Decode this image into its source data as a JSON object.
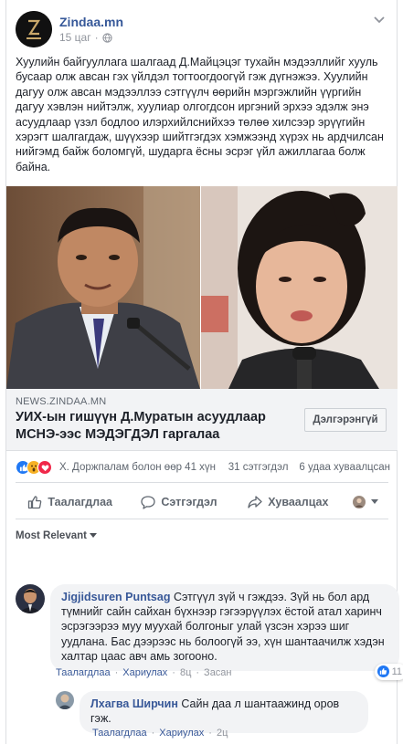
{
  "post": {
    "page_name": "Zindaa.mn",
    "time": "15 цаг",
    "dot": "·",
    "text": "Хуулийн байгууллага шалгаад Д.Майцэцэг тухайн мэдээллийг хууль бусаар олж авсан гэх үйлдэл тогтоогдоогүй гэж дүгнэжээ. Хуулийн дагуу олж авсан мэдээллээ сэтгүүлч өөрийн мэргэжлийн үүргийн дагуу хэвлэн нийтэлж, хуулиар олгогдсон иргэний эрхээ эдэлж энэ асуудлаар үзэл бодлоо илэрхийлснийхээ төлөө хилсээр эрүүгийн хэрэгт шалгагдаж, шүүхээр шийтгэгдэх хэмжээнд хүрэх нь ардчилсан нийгэмд байж боломгүй, шударга ёсны эсрэг үйл ажиллагаа болж байна."
  },
  "link": {
    "domain": "NEWS.ZINDAA.MN",
    "title": "УИХ-ын гишүүн Д.Муратын асуудлаар МСНЭ-ээс МЭДЭГДЭЛ гаргалаа",
    "more_button": "Дэлгэрэнгүй"
  },
  "stats": {
    "reactions_text": "Х. Доржпалам болон өөр 41 хүн",
    "comments": "31 сэтгэгдэл",
    "shares": "6 удаа хуваалцсан"
  },
  "actions": {
    "like": "Таалагдлаа",
    "comment": "Сэтгэгдэл",
    "share": "Хуваалцах"
  },
  "filter": {
    "label": "Most Relevant"
  },
  "comments": [
    {
      "author": "Jigjidsuren Puntsag",
      "text": "Сэтгүүл зүй ч гэждээ. Зүй нь бол ард түмнийг сайн сайхан бүхнээр гэгээрүүлэх ёстой атал харинч эсрэгээрээ муу муухай болгоныг улай үзсэн хэрээ шиг уудлана. Бас дээрээс нь болоогүй ээ, хүн шантаачилж хэдэн халтар цаас авч амь зогооно.",
      "like_label": "Таалагдлаа",
      "reply_label": "Хариулах",
      "time": "8ц",
      "edited": "Засан",
      "likes": "11"
    },
    {
      "author": "Лхагва Ширчин",
      "text": "Сайн даа л шантаажинд оров гэж.",
      "like_label": "Таалагдлаа",
      "reply_label": "Хариулах",
      "time": "2ц"
    }
  ],
  "colors": {
    "link_blue": "#385898",
    "meta_gray": "#90949c",
    "bubble_bg": "#f2f3f5",
    "like_blue": "#2078f4",
    "love_red": "#f0284a",
    "wow_yellow": "#f7b125"
  }
}
